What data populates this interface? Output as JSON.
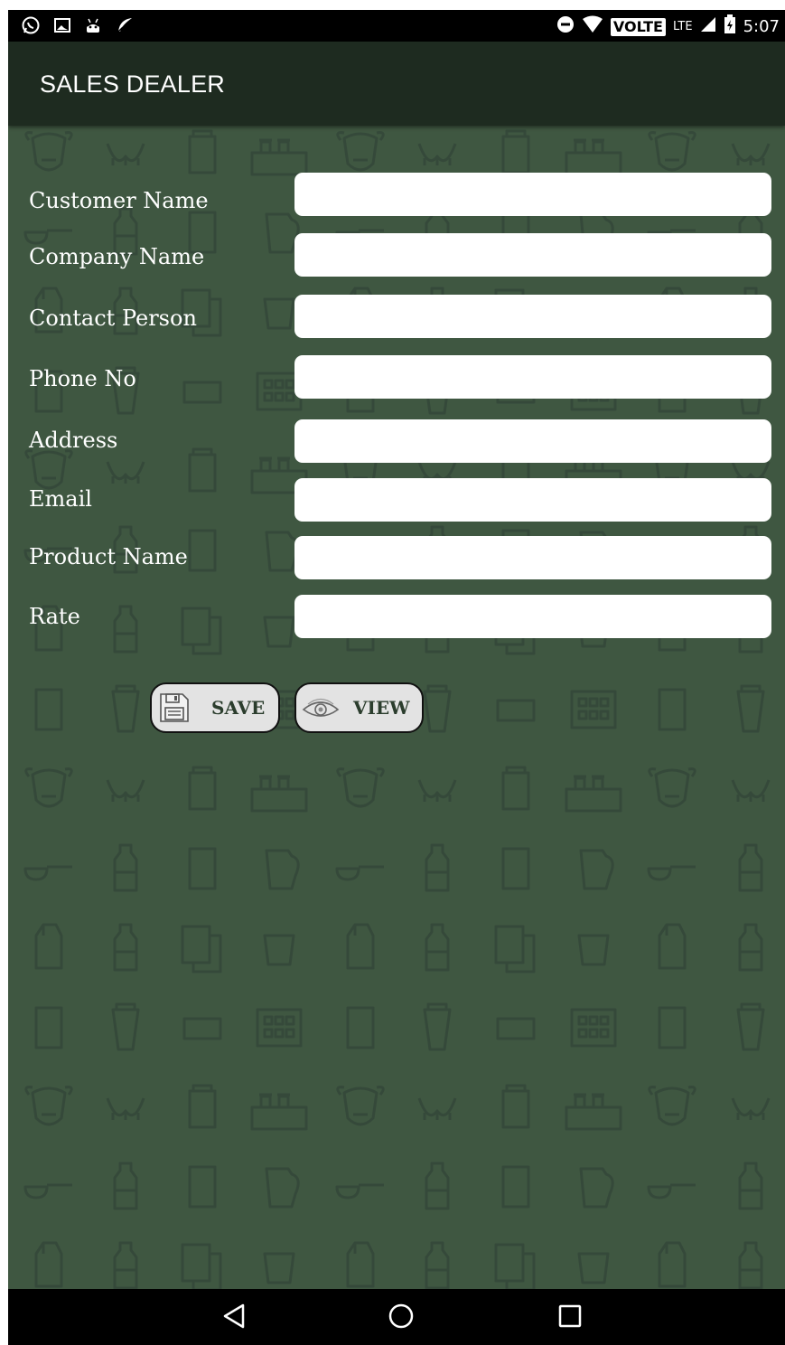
{
  "status_bar": {
    "left_icons": [
      "whatsapp-icon",
      "image-icon",
      "android-icon",
      "feather-icon"
    ],
    "volte_label": "VOLTE",
    "network_label": "LTE",
    "time": "5:07"
  },
  "app_bar": {
    "title": "SALES DEALER"
  },
  "form": {
    "fields": [
      {
        "label": "Customer Name",
        "value": ""
      },
      {
        "label": "Company Name",
        "value": ""
      },
      {
        "label": "Contact Person",
        "value": ""
      },
      {
        "label": "Phone No",
        "value": ""
      },
      {
        "label": "Address",
        "value": ""
      },
      {
        "label": "Email",
        "value": ""
      },
      {
        "label": "Product Name",
        "value": ""
      },
      {
        "label": "Rate",
        "value": ""
      }
    ]
  },
  "buttons": {
    "save_label": "SAVE",
    "view_label": "VIEW"
  },
  "nav_bar": {
    "icons": [
      "back-icon",
      "home-icon",
      "recents-icon"
    ]
  },
  "colors": {
    "background": "#3f5741",
    "app_bar": "#1e2b20",
    "pattern_stroke": "#35493a",
    "button_fill": "#e3e3e3",
    "button_text": "#2b3d2d"
  }
}
